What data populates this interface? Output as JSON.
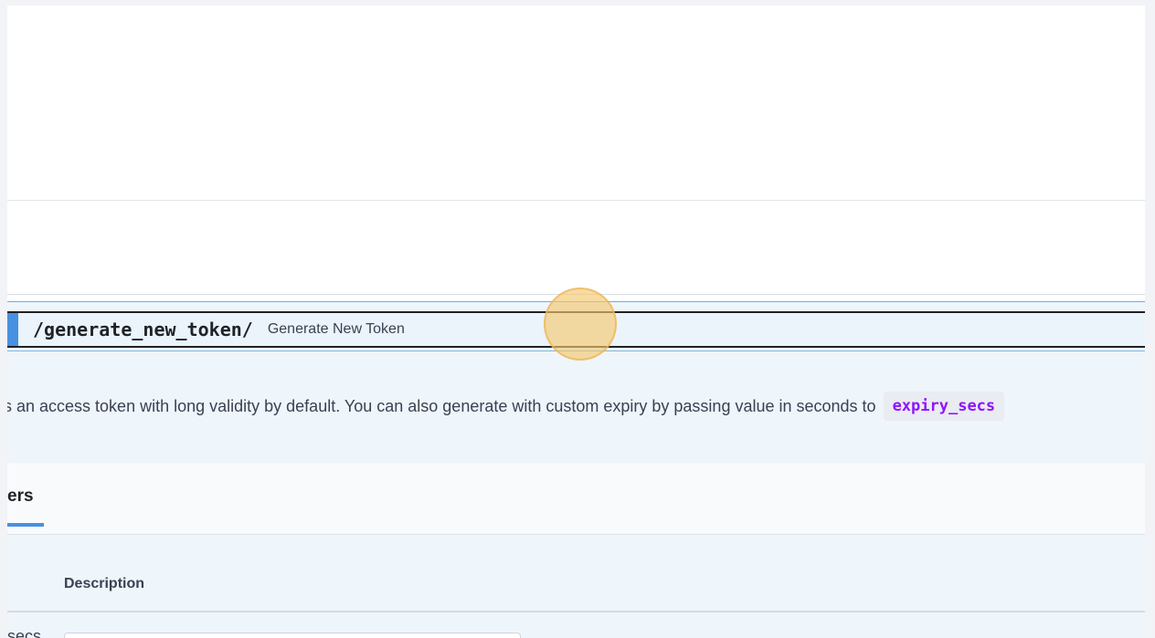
{
  "endpoint": {
    "path": "/generate_new_token/",
    "summary": "Generate New Token",
    "method_color": "#4990e2"
  },
  "description": {
    "text": "s an access token with long validity by default. You can also generate with custom expiry by passing value in seconds to",
    "code": "expiry_secs"
  },
  "tabs": {
    "active_label": "ers"
  },
  "parameters_table": {
    "column_description": "Description",
    "rows": [
      {
        "name": "secs",
        "value": ""
      }
    ]
  },
  "colors": {
    "accent": "#4990e2",
    "code": "#9012fe",
    "cursor_highlight": "#f5c86e"
  }
}
